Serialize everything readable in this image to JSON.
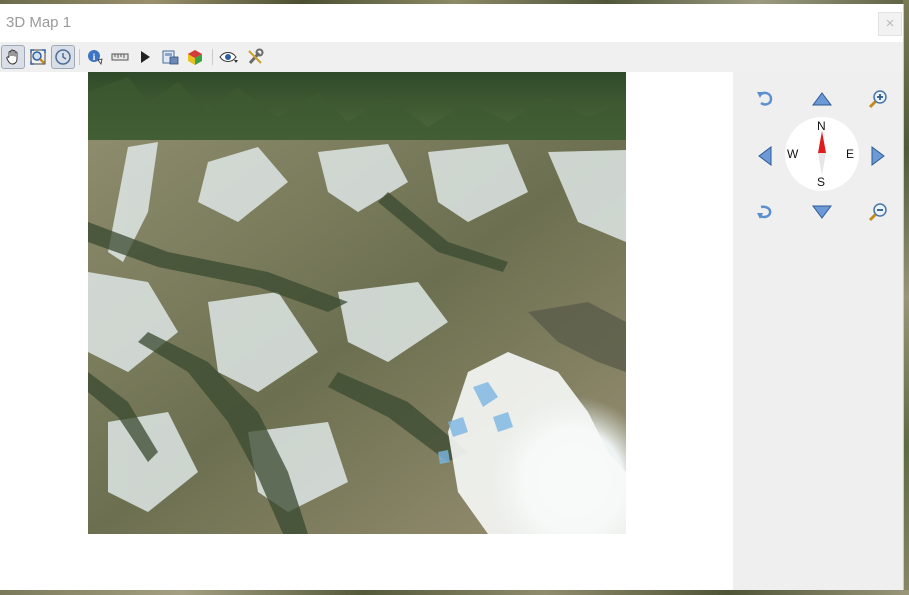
{
  "window": {
    "title": "3D Map 1",
    "close_glyph": "×"
  },
  "toolbar": {
    "buttons": [
      {
        "name": "pan-icon",
        "active": true
      },
      {
        "name": "zoom-full-icon",
        "active": false
      },
      {
        "name": "camera-orbit-icon",
        "active": true
      },
      {
        "name": "identify-icon",
        "active": false
      },
      {
        "name": "measure-icon",
        "active": false
      },
      {
        "name": "play-animation-icon",
        "active": false
      },
      {
        "name": "export-scene-icon",
        "active": false
      },
      {
        "name": "map-themes-icon",
        "active": false
      },
      {
        "name": "view-options-icon",
        "active": false
      },
      {
        "name": "configure-icon",
        "active": false
      }
    ]
  },
  "navigation": {
    "compass": {
      "north": "N",
      "south": "S",
      "east": "E",
      "west": "W"
    },
    "controls": [
      "rotate-left-icon",
      "pan-up-icon",
      "zoom-in-icon",
      "pan-left-icon",
      "pan-right-icon",
      "rotate-right-icon",
      "pan-down-icon",
      "zoom-out-icon"
    ]
  },
  "colors": {
    "accent": "#5b8fd0",
    "compass_needle": "#e01b1b",
    "snow": "#f3f6f5",
    "forest": "#33502e"
  }
}
